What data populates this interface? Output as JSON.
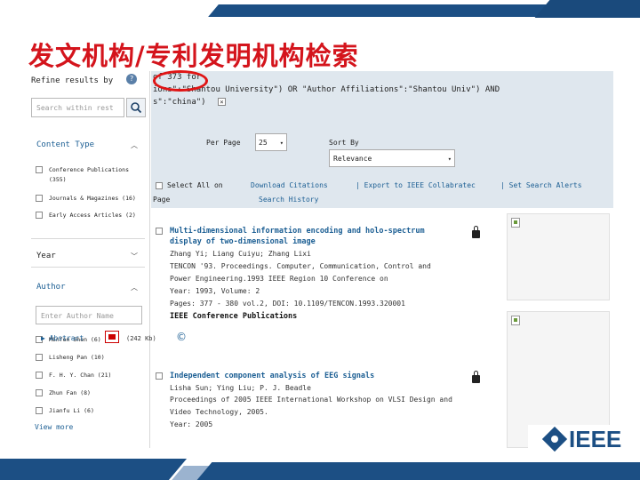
{
  "slide": {
    "title": "发文机构/专利发明机构检索",
    "logo_text": "IEEE"
  },
  "sidebar": {
    "refine_label": "Refine results by",
    "help_glyph": "?",
    "search_placeholder": "Search within rest",
    "content_type": {
      "heading": "Content Type",
      "items": [
        {
          "label": "Conference Publications",
          "label2": "(355)"
        },
        {
          "label": "Journals & Magazines (16)"
        },
        {
          "label": "Early Access Articles (2)"
        }
      ]
    },
    "year": {
      "heading": "Year"
    },
    "author": {
      "heading": "Author",
      "input_placeholder": "Enter Author Name",
      "items": [
        {
          "label": "Minfen Shen (6)"
        },
        {
          "label": "Lisheng Pan (10)"
        },
        {
          "label": "F. H. Y. Chan (21)"
        },
        {
          "label": "Zhun Fan (8)"
        },
        {
          "label": "Jianfu Li (6)"
        }
      ]
    },
    "view_more": "View more"
  },
  "query": {
    "line1": "of 373 for",
    "line2": "ions\":\"Shantou University\") OR \"Author Affiliations\":\"Shantou Univ\") AND",
    "line3": "s\":\"china\")",
    "close_glyph": "×",
    "per_page_label": "Per Page",
    "per_page_value": "25",
    "sort_by_label": "Sort By",
    "sort_by_value": "Relevance",
    "actions": [
      "Select All on",
      "Download Citations",
      "| Export to IEEE Collabratec",
      "| Set Search Alerts"
    ],
    "actions_line2": [
      "Page",
      "Search History"
    ]
  },
  "results": [
    {
      "title_lines": [
        "Multi-dimensional information encoding and holo-spectrum",
        "display of two-dimensional image"
      ],
      "authors": "Zhang Yi; Liang Cuiyu; Zhang Lixi",
      "venue_lines": [
        "TENCON '93. Proceedings. Computer, Communication, Control and",
        "Power Engineering.1993 IEEE Region 10 Conference on"
      ],
      "year_volume": "Year: 1993, Volume: 2",
      "pages_doi": "Pages: 377 - 380 vol.2, DOI: 10.1109/TENCON.1993.320001",
      "type_label": "IEEE Conference Publications",
      "abstract_label": "▶ Abstract",
      "size_label": "(242 Kb)",
      "copyright_glyph": "©"
    },
    {
      "title_lines": [
        "Independent component analysis of EEG signals"
      ],
      "authors": "Lisha Sun; Ying Liu; P. J. Beadle",
      "venue_lines": [
        "Proceedings of 2005 IEEE International Workshop on VLSI Design and",
        "Video Technology, 2005."
      ],
      "year_volume": "Year: 2005"
    }
  ]
}
